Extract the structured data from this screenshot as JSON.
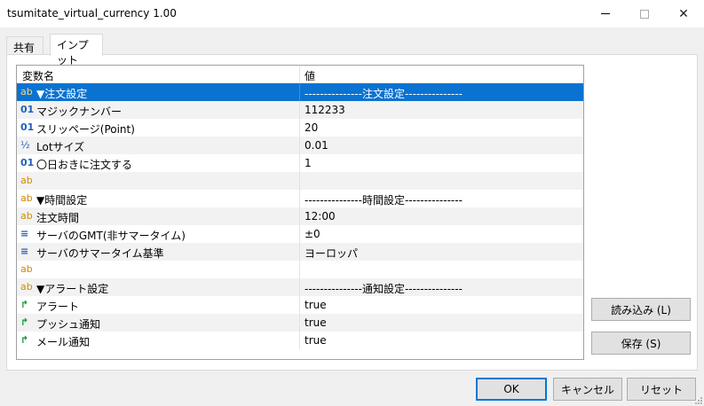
{
  "window": {
    "title": "tsumitate_virtual_currency 1.00",
    "close_glyph": "✕"
  },
  "tabs": [
    {
      "label": "共有"
    },
    {
      "label": "インプット"
    }
  ],
  "grid": {
    "headers": {
      "name": "変数名",
      "value": "値"
    },
    "rows": [
      {
        "icon": "ab",
        "name": "▼注文設定",
        "value": "---------------注文設定---------------"
      },
      {
        "icon": "01",
        "name": "マジックナンバー",
        "value": "112233"
      },
      {
        "icon": "01",
        "name": "スリッページ(Point)",
        "value": "20"
      },
      {
        "icon": "½",
        "name": "Lotサイズ",
        "value": "0.01"
      },
      {
        "icon": "01",
        "name": "〇日おきに注文する",
        "value": "1"
      },
      {
        "icon": "ab",
        "name": "",
        "value": ""
      },
      {
        "icon": "ab",
        "name": "▼時間設定",
        "value": "---------------時間設定---------------"
      },
      {
        "icon": "ab",
        "name": "注文時間",
        "value": "12:00"
      },
      {
        "icon": "≡",
        "name": "サーバのGMT(非サマータイム)",
        "value": "±0"
      },
      {
        "icon": "≡",
        "name": "サーバのサマータイム基準",
        "value": "ヨーロッパ"
      },
      {
        "icon": "ab",
        "name": "",
        "value": ""
      },
      {
        "icon": "ab",
        "name": "▼アラート設定",
        "value": "---------------通知設定---------------"
      },
      {
        "icon": "↱",
        "name": "アラート",
        "value": "true"
      },
      {
        "icon": "↱",
        "name": "プッシュ通知",
        "value": "true"
      },
      {
        "icon": "↱",
        "name": "メール通知",
        "value": "true"
      }
    ]
  },
  "buttons": {
    "load": "読み込み (L)",
    "save": "保存 (S)",
    "ok": "OK",
    "cancel": "キャンセル",
    "reset": "リセット"
  },
  "colors": {
    "selection": "#0a73d1",
    "ok_border": "#0078d7"
  }
}
